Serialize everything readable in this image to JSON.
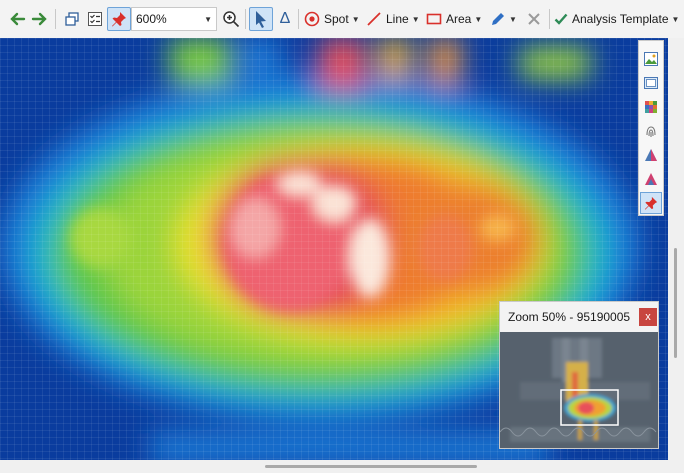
{
  "toolbar": {
    "back_icon": "arrow-left-icon",
    "forward_icon": "arrow-right-icon",
    "zoom_value": "600%",
    "spot_label": "Spot",
    "line_label": "Line",
    "area_label": "Area",
    "analysis_template_label": "Analysis Template",
    "accent_color": "#2e8b57",
    "tool_color": "#d9302b"
  },
  "zoom_panel": {
    "title": "Zoom 50% - 95190005",
    "close_label": "x"
  },
  "palette": {
    "icons": [
      "image-icon",
      "frame-icon",
      "color-palette-icon",
      "fingerprint-icon",
      "isotherm-icon",
      "isotherm-alt-icon",
      "pin-icon"
    ]
  }
}
